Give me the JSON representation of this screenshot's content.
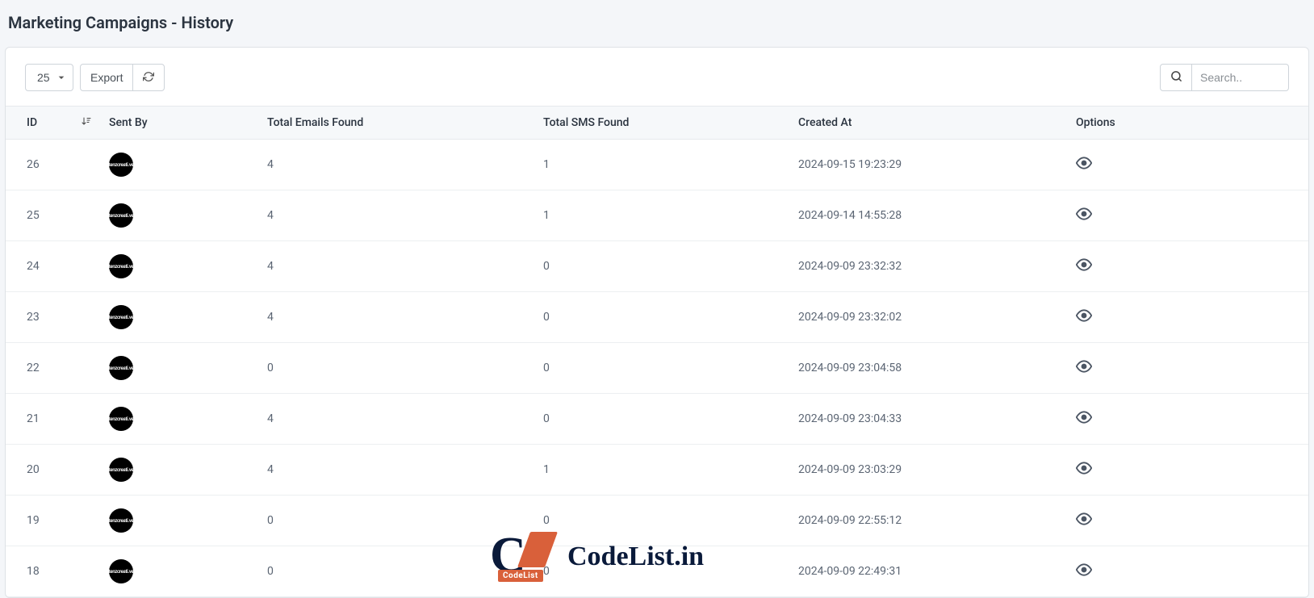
{
  "header": {
    "title": "Marketing Campaigns - History"
  },
  "toolbar": {
    "page_size": "25",
    "export_label": "Export",
    "search_placeholder": "Search.."
  },
  "table": {
    "columns": {
      "id": "ID",
      "sent_by": "Sent By",
      "total_emails": "Total Emails Found",
      "total_sms": "Total SMS Found",
      "created_at": "Created At",
      "options": "Options"
    },
    "sent_by_avatar_text": "tenzcreati.ve",
    "rows": [
      {
        "id": "26",
        "total_emails": "4",
        "total_sms": "1",
        "created_at": "2024-09-15 19:23:29"
      },
      {
        "id": "25",
        "total_emails": "4",
        "total_sms": "1",
        "created_at": "2024-09-14 14:55:28"
      },
      {
        "id": "24",
        "total_emails": "4",
        "total_sms": "0",
        "created_at": "2024-09-09 23:32:32"
      },
      {
        "id": "23",
        "total_emails": "4",
        "total_sms": "0",
        "created_at": "2024-09-09 23:32:02"
      },
      {
        "id": "22",
        "total_emails": "0",
        "total_sms": "0",
        "created_at": "2024-09-09 23:04:58"
      },
      {
        "id": "21",
        "total_emails": "4",
        "total_sms": "0",
        "created_at": "2024-09-09 23:04:33"
      },
      {
        "id": "20",
        "total_emails": "4",
        "total_sms": "1",
        "created_at": "2024-09-09 23:03:29"
      },
      {
        "id": "19",
        "total_emails": "0",
        "total_sms": "0",
        "created_at": "2024-09-09 22:55:12"
      },
      {
        "id": "18",
        "total_emails": "0",
        "total_sms": "0",
        "created_at": "2024-09-09 22:49:31"
      }
    ]
  },
  "watermark": {
    "sub": "CodeList",
    "text": "CodeList.in"
  }
}
